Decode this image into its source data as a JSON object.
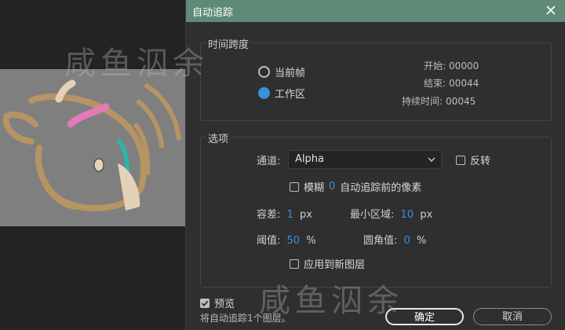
{
  "dialog": {
    "title": "自动追踪",
    "time_span": {
      "legend": "时间跨度",
      "options": [
        {
          "label": "当前帧",
          "selected": false
        },
        {
          "label": "工作区",
          "selected": true
        }
      ],
      "info": [
        {
          "label": "开始:",
          "value": "00000"
        },
        {
          "label": "结束:",
          "value": "00044"
        },
        {
          "label": "持续时间:",
          "value": "00045"
        }
      ]
    },
    "options": {
      "legend": "选项",
      "channel_label": "通道:",
      "channel_value": "Alpha",
      "invert_label": "反转",
      "invert_checked": false,
      "blur_label": "模糊",
      "blur_value": "0",
      "blur_suffix": "自动追踪前的像素",
      "blur_checked": false,
      "tolerance_label": "容差:",
      "tolerance_value": "1",
      "tolerance_unit": "px",
      "min_area_label": "最小区域:",
      "min_area_value": "10",
      "min_area_unit": "px",
      "threshold_label": "阈值:",
      "threshold_value": "50",
      "threshold_unit": "%",
      "corner_label": "圆角值:",
      "corner_value": "0",
      "corner_unit": "%",
      "apply_new_layer_label": "应用到新图层",
      "apply_new_layer_checked": false
    },
    "preview_label": "预览",
    "preview_checked": true,
    "status_text": "将自动追踪1个图层。",
    "ok_label": "确定",
    "cancel_label": "取消"
  },
  "watermark": "咸鱼泅余",
  "colors": {
    "titlebar": "#5f8a78",
    "accent": "#3b8fe0",
    "dialog_bg": "#2f2f2f"
  }
}
